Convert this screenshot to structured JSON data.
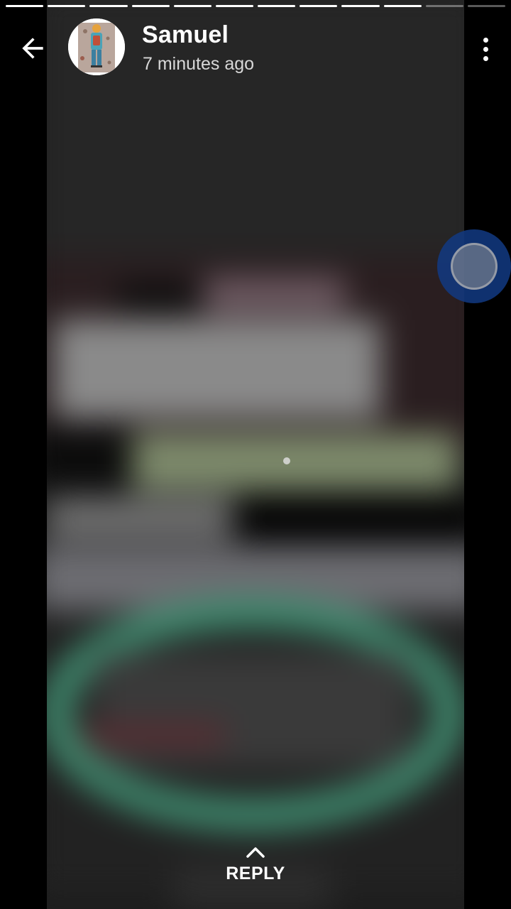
{
  "status_viewer": {
    "progress": {
      "total_segments": 12,
      "seen_segments": 10
    },
    "contact": {
      "name": "Samuel",
      "timestamp": "7 minutes ago",
      "avatar_icon": "person-with-backpack-avatar"
    },
    "icons": {
      "back": "arrow-left-icon",
      "menu": "more-vertical-icon",
      "reply": "chevron-up-icon"
    },
    "reply_label": "REPLY"
  },
  "overlay": {
    "floating_touch_color": "#123a82"
  }
}
